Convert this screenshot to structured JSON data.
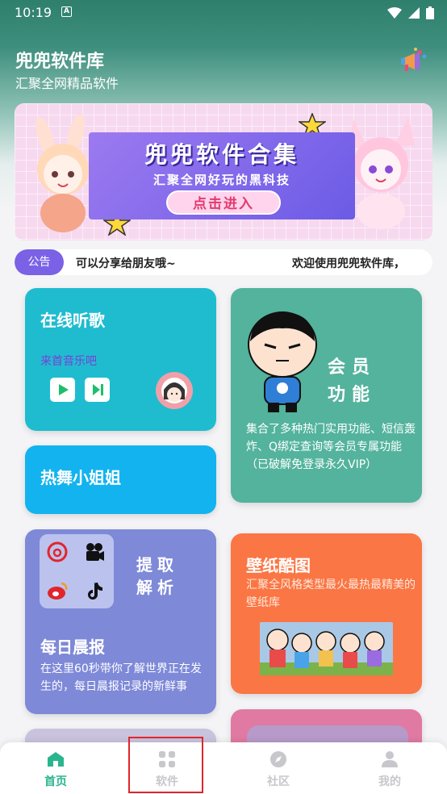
{
  "status_bar": {
    "time": "10:19",
    "badge": "A"
  },
  "header": {
    "title": "兜兜软件库",
    "subtitle": "汇聚全网精品软件",
    "action_icon": "megaphone-icon"
  },
  "banner": {
    "title": "兜兜软件合集",
    "subtitle": "汇聚全网好玩的黑科技",
    "button": "点击进入"
  },
  "notice": {
    "tag": "公告",
    "text": "可以分享给朋友哦~",
    "text2": "欢迎使用兜兜软件库，"
  },
  "cards": {
    "music": {
      "title": "在线听歌",
      "subtitle": "来首音乐吧"
    },
    "member": {
      "line1": "会员",
      "line2": "功能",
      "desc": "集合了多种热门实用功能、短信轰炸、Q绑定查询等会员专属功能（已破解免登录永久VIP）"
    },
    "dance": {
      "title": "热舞小姐姐"
    },
    "extract": {
      "line1": "提取",
      "line2": "解析",
      "title": "每日晨报",
      "desc": "在这里60秒带你了解世界正在发生的，每日晨报记录的新鲜事"
    },
    "wallpaper": {
      "title": "壁纸酷图",
      "desc": "汇聚全风格类型最火最热最精美的壁纸库"
    }
  },
  "bottom_nav": [
    {
      "label": "首页",
      "icon": "home-icon",
      "active": true
    },
    {
      "label": "软件",
      "icon": "apps-icon",
      "active": false
    },
    {
      "label": "社区",
      "icon": "compass-icon",
      "active": false
    },
    {
      "label": "我的",
      "icon": "person-icon",
      "active": false
    }
  ],
  "colors": {
    "accent": "#2ab58f",
    "notice_tag": "#7a61e6"
  }
}
